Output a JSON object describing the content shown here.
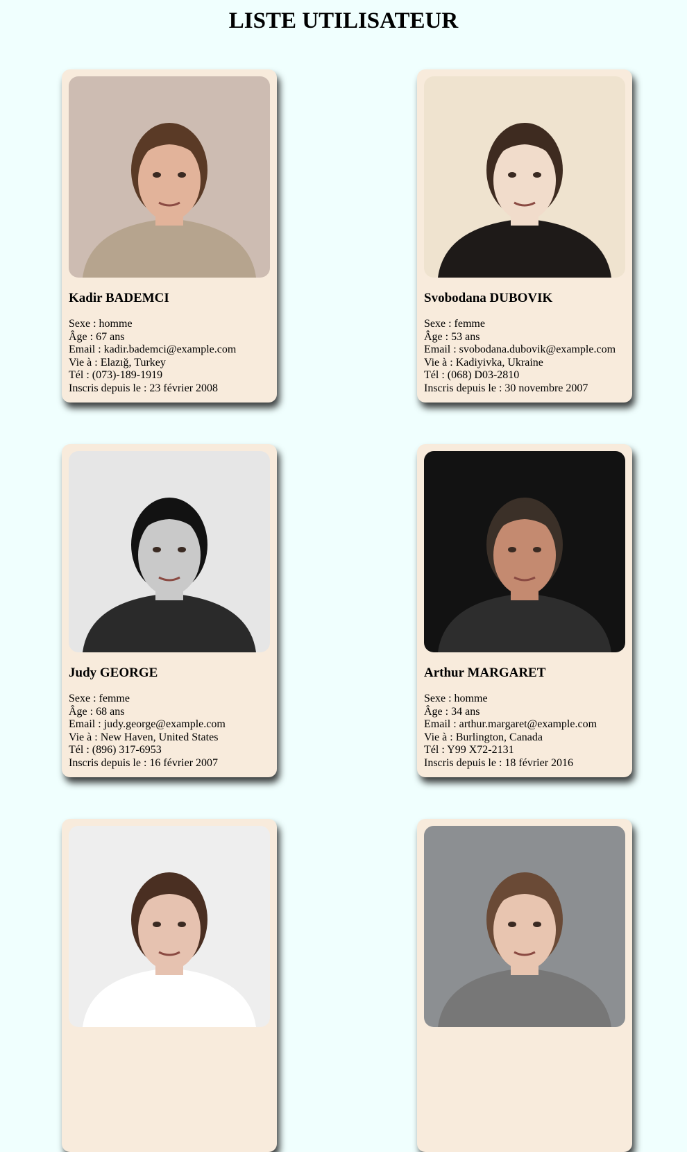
{
  "page": {
    "title": "LISTE UTILISATEUR"
  },
  "labels": {
    "sexe": "Sexe : ",
    "age": "Âge : ",
    "age_unit": " ans",
    "email": "Email : ",
    "city": "Vie à : ",
    "phone": "Tél : ",
    "registered": "Inscris depuis le : "
  },
  "users": [
    {
      "name": "Kadir BADEMCI",
      "gender": "homme",
      "age": "67",
      "email": "kadir.bademci@example.com",
      "location": "Elazığ, Turkey",
      "phone": "(073)-189-1919",
      "registered": "23 février 2008",
      "photo": {
        "bg": "#cdbcb2",
        "skin": "#e2b39a",
        "hair": "#5a3a26",
        "cloth": "#b6a48e"
      }
    },
    {
      "name": "Svobodana DUBOVIK",
      "gender": "femme",
      "age": "53",
      "email": "svobodana.dubovik@example.com",
      "location": "Kadiyivka, Ukraine",
      "phone": "(068) D03-2810",
      "registered": "30 novembre 2007",
      "photo": {
        "bg": "#efe3cf",
        "skin": "#f1dccb",
        "hair": "#3e2b20",
        "cloth": "#1e1a18"
      }
    },
    {
      "name": "Judy GEORGE",
      "gender": "femme",
      "age": "68",
      "email": "judy.george@example.com",
      "location": "New Haven, United States",
      "phone": "(896) 317-6953",
      "registered": "16 février 2007",
      "photo": {
        "bg": "#e6e6e6",
        "skin": "#c9c9c9",
        "hair": "#121212",
        "cloth": "#2a2a2a"
      }
    },
    {
      "name": "Arthur MARGARET",
      "gender": "homme",
      "age": "34",
      "email": "arthur.margaret@example.com",
      "location": "Burlington, Canada",
      "phone": "Y99 X72-2131",
      "registered": "18 février 2016",
      "photo": {
        "bg": "#121212",
        "skin": "#c48a70",
        "hair": "#3b3028",
        "cloth": "#2d2d2d"
      }
    },
    {
      "name": "",
      "gender": "",
      "age": "",
      "email": "",
      "location": "",
      "phone": "",
      "registered": "",
      "photo": {
        "bg": "#eeeeee",
        "skin": "#e6c2b0",
        "hair": "#4a2f22",
        "cloth": "#ffffff"
      }
    },
    {
      "name": "",
      "gender": "",
      "age": "",
      "email": "",
      "location": "",
      "phone": "",
      "registered": "",
      "photo": {
        "bg": "#8c8f92",
        "skin": "#e8c5b0",
        "hair": "#6a4a36",
        "cloth": "#777777"
      }
    }
  ]
}
